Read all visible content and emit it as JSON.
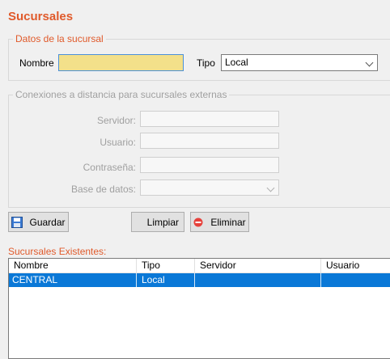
{
  "title": "Sucursales",
  "datos_group": {
    "legend": "Datos de la sucursal",
    "nombre_label": "Nombre",
    "nombre_value": "",
    "tipo_label": "Tipo",
    "tipo_value": "Local"
  },
  "conexiones_group": {
    "legend": "Conexiones a distancia para sucursales externas",
    "servidor_label": "Servidor:",
    "usuario_label": "Usuario:",
    "contrasena_label": "Contraseña:",
    "base_label": "Base de datos:"
  },
  "buttons": {
    "guardar": "Guardar",
    "limpiar": "Limpiar",
    "eliminar": "Eliminar"
  },
  "existentes": {
    "label": "Sucursales Existentes:",
    "columns": [
      "Nombre",
      "Tipo",
      "Servidor",
      "Usuario"
    ],
    "rows": [
      {
        "nombre": "CENTRAL",
        "tipo": "Local",
        "servidor": "",
        "usuario": ""
      }
    ]
  },
  "colors": {
    "accent": "#e05a2b",
    "selection": "#0a78d7",
    "name_field_bg": "#f3e08a"
  },
  "icons": {
    "guardar": "save-disk-icon",
    "eliminar": "delete-circle-icon"
  }
}
